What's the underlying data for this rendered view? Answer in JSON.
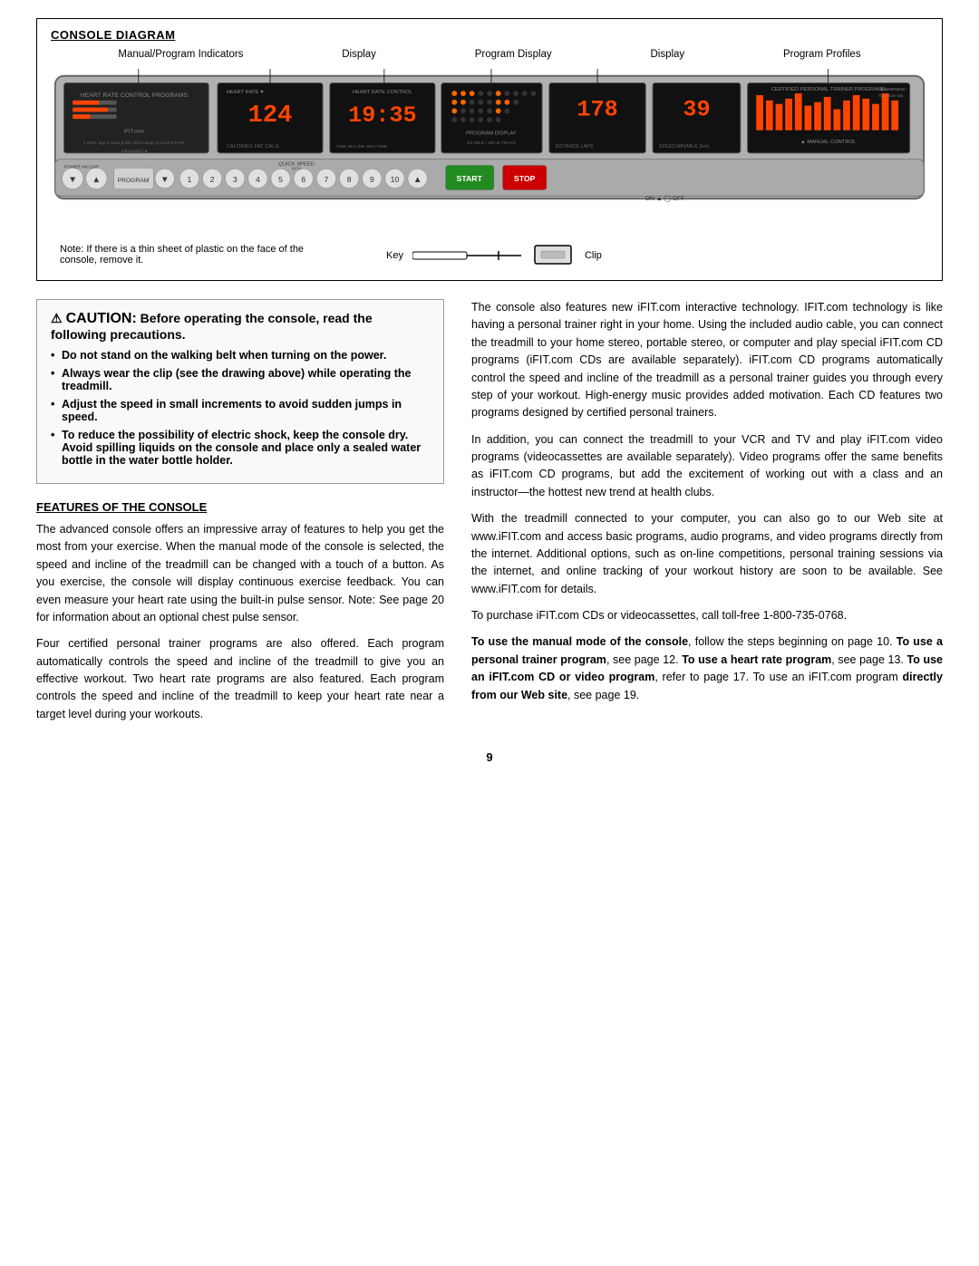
{
  "console_section": {
    "title": "CONSOLE DIAGRAM",
    "labels": [
      "Manual/Program Indicators",
      "Display",
      "Program Display",
      "Display",
      "Program Profiles"
    ],
    "panels": {
      "digits": [
        "124",
        "1935",
        "178",
        "39"
      ],
      "sub_labels": [
        "CALORIES  FAT CALS.",
        "TIME  INCLINE  SEG.TIME",
        "DISTANCE   LAPS",
        "SPEED  MIN/MILE (km)"
      ],
      "program_display_label": "PROGRAM DISPLAY",
      "quarter_mile_label": "1/4 MILE / 400 M TRACK",
      "quick_speed_label": "QUICK SPEED",
      "manual_control_label": "MANUAL CONTROL"
    },
    "buttons": [
      "▼",
      "▲",
      "PROGRAM",
      "▼",
      "1",
      "2",
      "3",
      "4",
      "5",
      "6",
      "7",
      "8",
      "9",
      "10",
      "▲",
      "START",
      "STOP"
    ],
    "note": "Note: If there is a thin sheet of plastic on the face of the console, remove it.",
    "key_label": "Key",
    "clip_label": "Clip"
  },
  "caution": {
    "icon": "⚠",
    "word": "CAUTION:",
    "subtitle": "Before operating the console, read the following precautions.",
    "items": [
      {
        "text": "Do not stand on the walking belt when turning on the power.",
        "bold": true
      },
      {
        "text": "Always wear the clip (see the drawing above) while operating the treadmill.",
        "bold": true
      },
      {
        "text": "Adjust the speed in small increments to avoid sudden jumps in speed.",
        "bold": true
      },
      {
        "text": "To reduce the possibility of electric shock, keep the console dry. Avoid spilling liquids on the console and place only a sealed water bottle in the water bottle holder.",
        "bold": true
      }
    ]
  },
  "features": {
    "title": "FEATURES OF THE CONSOLE",
    "paragraphs": [
      "The advanced console offers an impressive array of features to help you get the most from your exercise. When the manual mode of the console is selected, the speed and incline of the treadmill can be changed with a touch of a button. As you exercise, the console will display continuous exercise feedback. You can even measure your heart rate using the built-in pulse sensor. Note: See page 20 for information about an optional chest pulse sensor.",
      "Four certified personal trainer programs are also offered. Each program automatically controls the speed and incline of the treadmill to give you an effective workout. Two heart rate programs are also featured. Each program controls the speed and incline of the treadmill to keep your heart rate near a target level during your workouts."
    ]
  },
  "right_column": {
    "paragraphs": [
      "The console also features new iFIT.com interactive technology. IFIT.com technology is like having a personal trainer right in your home. Using the included audio cable, you can connect the treadmill to your home stereo, portable stereo, or computer and play special iFIT.com CD programs (iFIT.com CDs are available separately). iFIT.com CD programs automatically control the speed and incline of the treadmill as a personal trainer guides you through every step of your workout. High-energy music provides added motivation. Each CD features two programs designed by certified personal trainers.",
      "In addition, you can connect the treadmill to your VCR and TV and play iFIT.com video programs (videocassettes are available separately). Video programs offer the same benefits as iFIT.com CD programs, but add the excitement of working out with a class and an instructor—the hottest new trend at health clubs.",
      "With the treadmill connected to your computer, you can also go to our Web site at www.iFIT.com and access basic programs, audio programs, and video programs directly from the internet. Additional options, such as on-line competitions, personal training sessions via the internet, and online tracking of your workout history are soon to be available. See www.iFIT.com for details.",
      "To purchase iFIT.com CDs or videocassettes, call toll-free 1-800-735-0768.",
      "To use the manual mode of the console, follow the steps beginning on page 10. To use a personal trainer program, see page 12. To use a heart rate program, see page 13. To use an iFIT.com CD or video program, refer to page 17. To use an iFIT.com program directly from our Web site, see page 19."
    ],
    "bold_parts": [
      "To use the manual mode of the console",
      "To use a personal trainer program",
      "To use a heart rate program",
      "To use an iFIT.com CD or video program",
      "directly from our Web site"
    ]
  },
  "page_number": "9"
}
